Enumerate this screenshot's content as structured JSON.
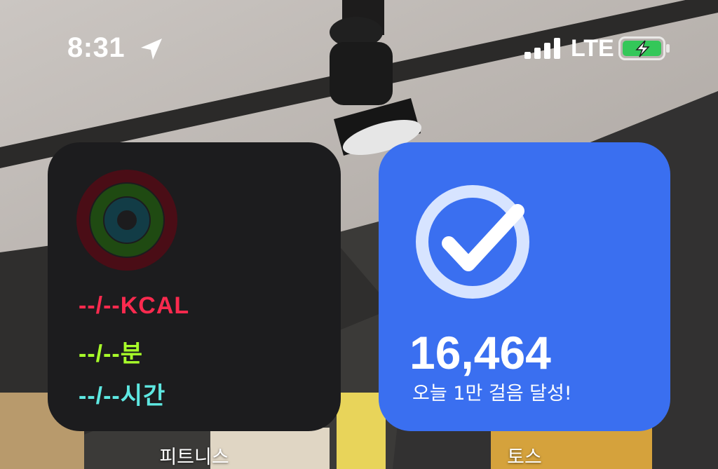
{
  "status_bar": {
    "time": "8:31",
    "location_icon": "location-arrow-icon",
    "signal_icon": "cellular-signal-icon",
    "network": "LTE",
    "battery_icon": "battery-charging-icon",
    "battery_color": "#34c759"
  },
  "widgets": {
    "fitness": {
      "rings_icon": "activity-rings-icon",
      "move": "--/--KCAL",
      "exercise": "--/--분",
      "stand": "--/--시간",
      "colors": {
        "move": "#fa2a4e",
        "exercise": "#a8ff2a",
        "stand": "#5ee8e2"
      },
      "label": "피트니스"
    },
    "toss": {
      "check_icon": "check-circle-icon",
      "steps": "16,464",
      "caption": "오늘 1만 걸음 달성!",
      "background": "#3a6ff0",
      "label": "토스"
    }
  }
}
